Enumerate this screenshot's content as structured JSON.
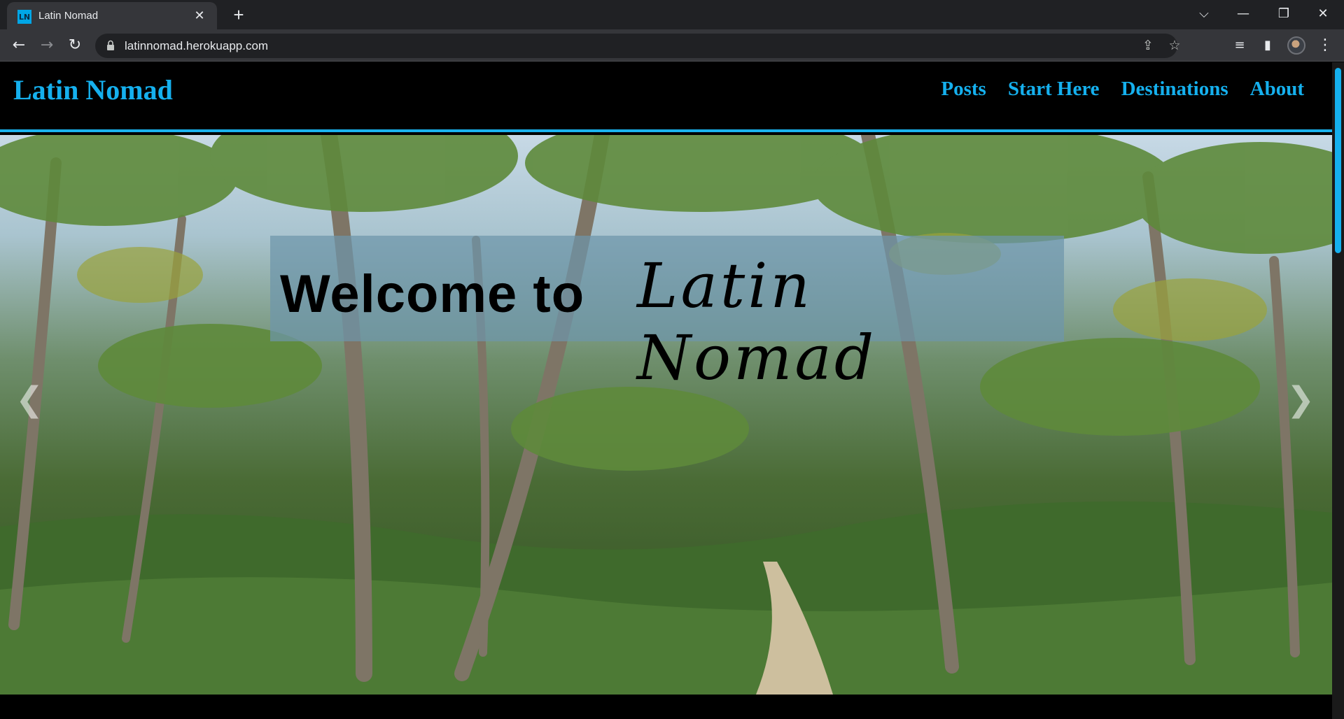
{
  "browser": {
    "tab": {
      "favicon_text": "LN",
      "title": "Latin Nomad"
    },
    "url": "latinnomad.herokuapp.com",
    "icons": {
      "back": "back-arrow-icon",
      "forward": "forward-arrow-icon",
      "reload": "reload-icon",
      "share": "share-icon",
      "bookmark": "star-icon",
      "media": "media-queue-icon",
      "side_panel": "side-panel-icon",
      "menu": "kebab-menu-icon"
    }
  },
  "site": {
    "logo": "Latin Nomad",
    "nav": [
      "Posts",
      "Start Here",
      "Destinations",
      "About"
    ],
    "accent_color": "#15b0ee"
  },
  "hero": {
    "welcome_plain": "Welcome to",
    "welcome_script": "Latin Nomad",
    "prev_arrow": "❮",
    "next_arrow": "❯"
  }
}
